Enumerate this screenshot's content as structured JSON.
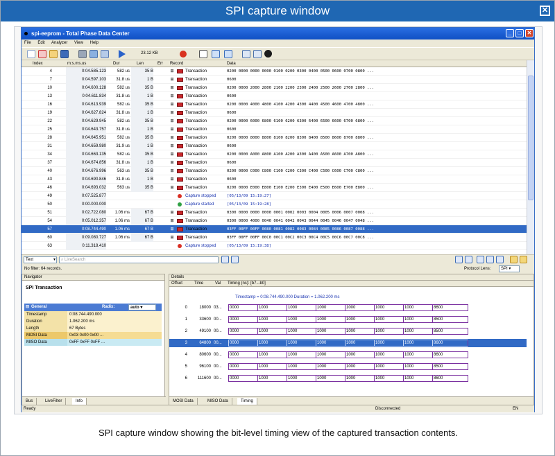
{
  "header": {
    "title": "SPI capture window"
  },
  "app": {
    "title": "spi-eeprom - Total Phase Data Center",
    "menu": [
      "File",
      "Edit",
      "Analyzer",
      "View",
      "Help"
    ],
    "capture_size": "23.12 KB"
  },
  "grid": {
    "columns": [
      "Index",
      "m:s.ms.us",
      "Dur",
      "Len",
      "Err",
      "Record",
      "Data"
    ],
    "rows": [
      {
        "index": "4",
        "time": "0:04.585.123",
        "dur": "582 us",
        "len": "35 B",
        "record": "Transaction",
        "data": "0200 0000 0000 0000 0100 0200 0300 0400 0500 0600 0700 0800 ..."
      },
      {
        "index": "7",
        "time": "0:04.597.103",
        "dur": "31.8 us",
        "len": "1 B",
        "record": "Transaction",
        "data": "0600"
      },
      {
        "index": "10",
        "time": "0:04.600.128",
        "dur": "582 us",
        "len": "35 B",
        "record": "Transaction",
        "data": "0200 0000 2000 2800 2100 2200 2300 2400 2500 2600 2700 2800 ..."
      },
      {
        "index": "13",
        "time": "0:04.611.834",
        "dur": "31.8 us",
        "len": "1 B",
        "record": "Transaction",
        "data": "0600"
      },
      {
        "index": "16",
        "time": "0:04.613.939",
        "dur": "582 us",
        "len": "35 B",
        "record": "Transaction",
        "data": "0200 0000 4000 4800 4100 4200 4300 4400 4500 4600 4700 4800 ..."
      },
      {
        "index": "19",
        "time": "0:04.627.824",
        "dur": "31.8 us",
        "len": "1 B",
        "record": "Transaction",
        "data": "0600"
      },
      {
        "index": "22",
        "time": "0:04.629.945",
        "dur": "582 us",
        "len": "35 B",
        "record": "Transaction",
        "data": "0200 0000 6000 6800 6100 6200 6300 6400 6500 6600 6700 6800 ..."
      },
      {
        "index": "25",
        "time": "0:04.643.757",
        "dur": "31.8 us",
        "len": "1 B",
        "record": "Transaction",
        "data": "0600"
      },
      {
        "index": "28",
        "time": "0:04.645.951",
        "dur": "582 us",
        "len": "35 B",
        "record": "Transaction",
        "data": "0200 0000 8000 8800 8100 8200 8300 8400 8500 8600 8700 8800 ..."
      },
      {
        "index": "31",
        "time": "0:04.659.980",
        "dur": "31.9 us",
        "len": "1 B",
        "record": "Transaction",
        "data": "0600"
      },
      {
        "index": "34",
        "time": "0:04.663.135",
        "dur": "582 us",
        "len": "35 B",
        "record": "Transaction",
        "data": "0200 0000 A000 A800 A100 A200 A300 A400 A500 A600 A700 A800 ..."
      },
      {
        "index": "37",
        "time": "0:04.674.856",
        "dur": "31.8 us",
        "len": "1 B",
        "record": "Transaction",
        "data": "0600"
      },
      {
        "index": "40",
        "time": "0:04.676.996",
        "dur": "563 us",
        "len": "35 B",
        "record": "Transaction",
        "data": "0200 0000 C000 C800 C100 C200 C300 C400 C500 C600 C700 C800 ..."
      },
      {
        "index": "43",
        "time": "0:04.690.846",
        "dur": "31.8 us",
        "len": "1 B",
        "record": "Transaction",
        "data": "0600"
      },
      {
        "index": "46",
        "time": "0:04.693.032",
        "dur": "563 us",
        "len": "35 B",
        "record": "Transaction",
        "data": "0200 0000 E000 E800 E100 E200 E300 E400 E500 E600 E700 E800 ..."
      },
      {
        "index": "49",
        "time": "0:07.525.877",
        "dur": "",
        "len": "",
        "record": "Capture stopped",
        "data": "[05/13/09 15:19:27]"
      },
      {
        "index": "50",
        "time": "0:00.000.000",
        "dur": "",
        "len": "",
        "record": "Capture started",
        "data": "[05/13/09 15:19:28]"
      },
      {
        "index": "51",
        "time": "0:02.722.080",
        "dur": "1.06 ms",
        "len": "67 B",
        "record": "Transaction",
        "data": "0300 0000 0000 0000 0001 0002 0003 0004 0005 0006 0007 0008 ..."
      },
      {
        "index": "54",
        "time": "0:05.012.357",
        "dur": "1.06 ms",
        "len": "67 B",
        "record": "Transaction",
        "data": "0300 0000 4000 0040 0041 0042 0043 0044 0045 0046 0047 0048 ..."
      },
      {
        "index": "57",
        "time": "0:08.744.490",
        "dur": "1.06 ms",
        "len": "67 B",
        "record": "Transaction",
        "data": "03FF 00FF 00FF 0080 0081 0082 0083 0084 0085 0086 0087 0088 ..."
      },
      {
        "index": "60",
        "time": "0:09.080.727",
        "dur": "1.06 ms",
        "len": "67 B",
        "record": "Transaction",
        "data": "03FF 00FF 00FF 00C0 00C1 00C2 00C3 00C4 00C5 00C6 00C7 00C8 ..."
      },
      {
        "index": "63",
        "time": "0:11.318.410",
        "dur": "",
        "len": "",
        "record": "Capture stopped",
        "data": "[05/13/09 15:19:38]"
      }
    ],
    "selected_row": 19
  },
  "gridbar": {
    "mode": "Text",
    "search_placeholder": "LiveSearch"
  },
  "filterbar": {
    "status": "No filter: 64 records.",
    "protocol_lens_label": "Protocol Lens:",
    "protocol_lens_value": "SPI"
  },
  "navigator": {
    "header": "Navigator",
    "title": "SPI Transaction",
    "group": "General",
    "radix_label": "Radix:",
    "radix_value": "auto",
    "props": [
      {
        "key": "Timestamp",
        "value": "0:08.744.490.000"
      },
      {
        "key": "Duration",
        "value": "1.062.200 ms"
      },
      {
        "key": "Length",
        "value": "67 Bytes"
      },
      {
        "key": "MOSI Data",
        "value": "0x03 0x00 0x00 ..."
      },
      {
        "key": "MISO Data",
        "value": "0xFF 0xFF 0xFF ..."
      }
    ],
    "tabs": [
      "Bus",
      "LiveFilter",
      "Info"
    ]
  },
  "details": {
    "header": "Details",
    "columns": [
      "Offset",
      "Time",
      "Val",
      "Timing (ns): [b7...b0]"
    ],
    "timestamp_line": "Timestamp = 0:08.744.490.000  Duration = 1.062.200 ms",
    "rows": [
      {
        "offset": "0",
        "time": "18000",
        "val": "03...",
        "bits": [
          "0000",
          "1000",
          "1000",
          "1000",
          "1000",
          "1000",
          "1000",
          "8600"
        ]
      },
      {
        "offset": "1",
        "time": "33600",
        "val": "00...",
        "bits": [
          "0000",
          "1000",
          "1000",
          "1000",
          "1000",
          "1000",
          "1000",
          "8500"
        ]
      },
      {
        "offset": "2",
        "time": "49100",
        "val": "00...",
        "bits": [
          "0000",
          "1000",
          "1000",
          "1000",
          "1000",
          "1000",
          "1000",
          "8500"
        ]
      },
      {
        "offset": "3",
        "time": "64800",
        "val": "00...",
        "bits": [
          "0000",
          "1000",
          "1000",
          "1000",
          "1000",
          "1000",
          "1000",
          "8600"
        ]
      },
      {
        "offset": "4",
        "time": "80600",
        "val": "00...",
        "bits": [
          "0000",
          "1000",
          "1000",
          "1000",
          "1000",
          "1000",
          "1000",
          "8600"
        ]
      },
      {
        "offset": "5",
        "time": "96100",
        "val": "00...",
        "bits": [
          "0000",
          "1000",
          "1000",
          "1000",
          "1000",
          "1000",
          "1000",
          "8500"
        ]
      },
      {
        "offset": "6",
        "time": "111600",
        "val": "00...",
        "bits": [
          "0000",
          "1000",
          "1000",
          "1000",
          "1000",
          "1000",
          "1000",
          "8600"
        ]
      }
    ],
    "selected_row": 3,
    "tabs": [
      "MOSI Data",
      "MISO Data",
      "Timing"
    ]
  },
  "status": {
    "left": "Ready",
    "center": "Disconnected",
    "right": "EN"
  },
  "caption": "SPI capture window showing the bit-level timing view of the captured transaction contents."
}
